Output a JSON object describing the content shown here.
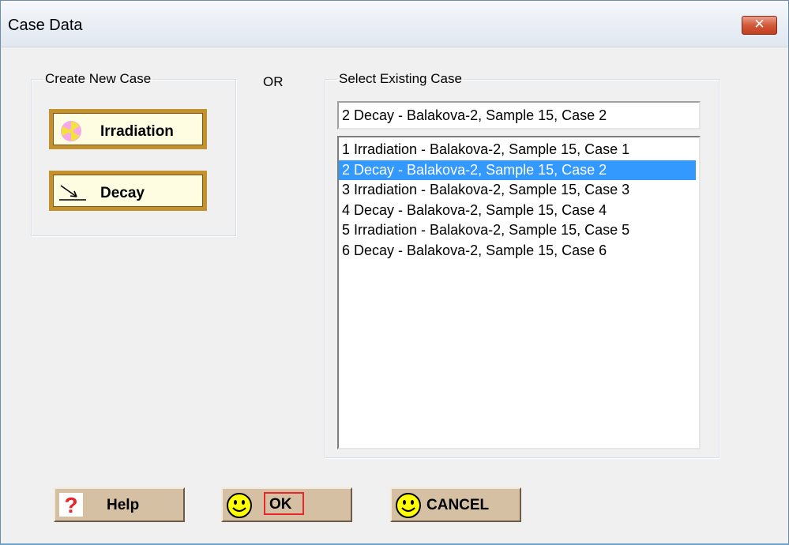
{
  "window": {
    "title": "Case Data",
    "close_glyph": "✕"
  },
  "create_group": {
    "legend": "Create New Case",
    "irradiation_label": "Irradiation",
    "decay_label": "Decay",
    "irradiation_icon": "radiation-icon",
    "decay_icon": "decay-arrow-icon"
  },
  "or_label": "OR",
  "existing_group": {
    "legend": "Select Existing Case",
    "selected_value": "2 Decay - Balakova-2, Sample 15, Case 2",
    "items": [
      {
        "label": "1 Irradiation - Balakova-2, Sample 15, Case 1",
        "selected": false
      },
      {
        "label": "2 Decay - Balakova-2, Sample 15, Case 2",
        "selected": true
      },
      {
        "label": "3 Irradiation - Balakova-2, Sample 15, Case 3",
        "selected": false
      },
      {
        "label": "4 Decay - Balakova-2, Sample 15, Case 4",
        "selected": false
      },
      {
        "label": "5 Irradiation - Balakova-2, Sample 15, Case 5",
        "selected": false
      },
      {
        "label": "6 Decay - Balakova-2, Sample 15, Case 6",
        "selected": false
      }
    ]
  },
  "buttons": {
    "help_label": "Help",
    "help_glyph": "?",
    "ok_label": "OK",
    "cancel_label": "CANCEL"
  },
  "colors": {
    "selection_blue": "#3399ff",
    "case_button_border": "#c4912f",
    "case_button_fill": "#fefde2",
    "bottom_button_fill": "#d6c0a4",
    "smiley_yellow": "#ffff00",
    "help_red": "#e8252b"
  }
}
